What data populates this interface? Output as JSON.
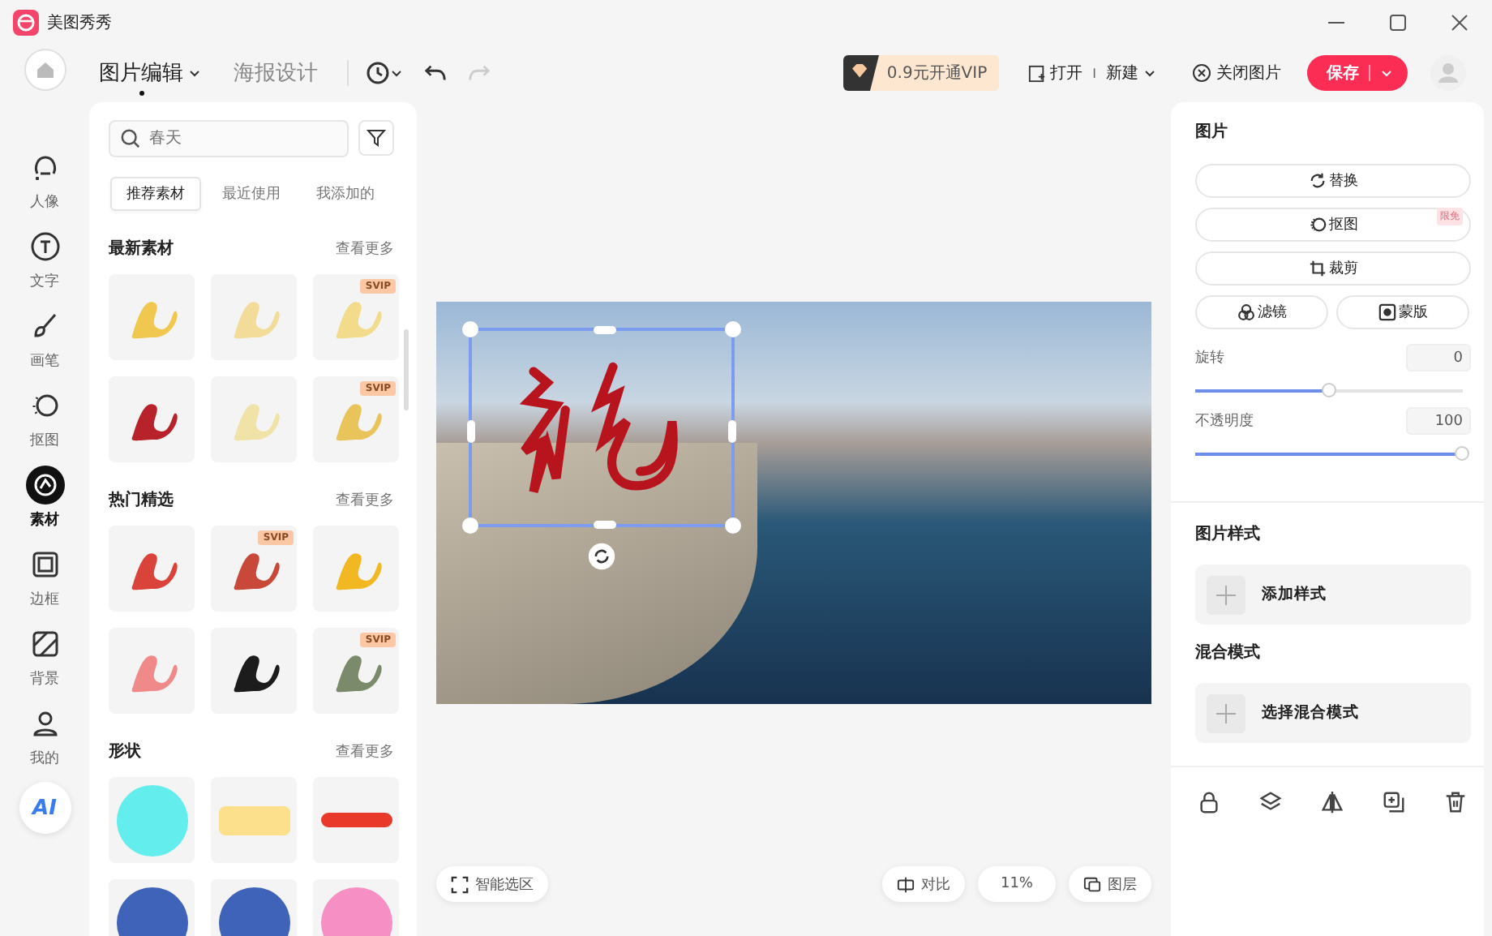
{
  "app": {
    "title": "美图秀秀"
  },
  "toolbar": {
    "modes": [
      {
        "label": "图片编辑",
        "selected": true,
        "dropdown": true
      },
      {
        "label": "海报设计",
        "selected": false,
        "dropdown": false
      }
    ],
    "redo_disabled": true,
    "vip": "0.9元开通VIP",
    "open": "打开",
    "separator": "I",
    "new": "新建",
    "close": "关闭图片",
    "save": "保存"
  },
  "rail": {
    "items": [
      {
        "label": "人像",
        "kind": "portrait",
        "selected": false
      },
      {
        "label": "文字",
        "kind": "text",
        "selected": false
      },
      {
        "label": "画笔",
        "kind": "brush",
        "selected": false
      },
      {
        "label": "抠图",
        "kind": "cutout",
        "selected": false
      },
      {
        "label": "素材",
        "kind": "sticker",
        "selected": true
      },
      {
        "label": "边框",
        "kind": "frame",
        "selected": false
      },
      {
        "label": "背景",
        "kind": "hatch",
        "selected": false
      },
      {
        "label": "我的",
        "kind": "user",
        "selected": false
      }
    ],
    "ai": "AI"
  },
  "panel": {
    "search": {
      "placeholder": "春天"
    },
    "tabs": [
      {
        "label": "推荐素材",
        "selected": true
      },
      {
        "label": "最近使用",
        "selected": false
      },
      {
        "label": "我添加的",
        "selected": false
      }
    ],
    "sections": [
      {
        "title": "最新素材",
        "more": "查看更多",
        "tiles": [
          {
            "kind": "sticker",
            "color": "#f0c850"
          },
          {
            "kind": "sticker",
            "color": "#f3dc9a"
          },
          {
            "kind": "sticker",
            "color": "#f2dc8c",
            "badge": "SVIP"
          },
          {
            "kind": "sticker",
            "color": "#b8222a"
          },
          {
            "kind": "sticker",
            "color": "#f1e2a8"
          },
          {
            "kind": "sticker",
            "color": "#e9c45a",
            "badge": "SVIP"
          }
        ]
      },
      {
        "title": "热门精选",
        "more": "查看更多",
        "tiles": [
          {
            "kind": "sticker",
            "color": "#d9433a"
          },
          {
            "kind": "sticker",
            "color": "#c8483a",
            "badge": "SVIP"
          },
          {
            "kind": "sticker",
            "color": "#f2b823"
          },
          {
            "kind": "sticker",
            "color": "#f08a8a"
          },
          {
            "kind": "sticker",
            "color": "#1c1c1c"
          },
          {
            "kind": "sticker",
            "color": "#7b8a6b",
            "badge": "SVIP"
          }
        ]
      },
      {
        "title": "形状",
        "more": "查看更多",
        "tiles": [
          {
            "kind": "circle",
            "color": "#63eded"
          },
          {
            "kind": "bar",
            "color": "#fde08c"
          },
          {
            "kind": "pill",
            "color": "#e8392a"
          },
          {
            "kind": "circle",
            "color": "#3f63b8"
          },
          {
            "kind": "circle",
            "color": "#3f63b8"
          },
          {
            "kind": "circle",
            "color": "#f58fc4"
          }
        ]
      }
    ]
  },
  "canvas": {
    "smart_select": "智能选区",
    "compare": "对比",
    "zoom": "11%",
    "layers": "图层"
  },
  "properties": {
    "title": "图片",
    "actions": [
      {
        "label": "替换",
        "kind": "refresh",
        "half": false
      },
      {
        "label": "抠图",
        "kind": "cutout",
        "half": false,
        "badge": "限免"
      },
      {
        "label": "裁剪",
        "kind": "crop",
        "half": false
      },
      {
        "label": "滤镜",
        "kind": "filter",
        "half": true
      },
      {
        "label": "蒙版",
        "kind": "mask",
        "half": true
      }
    ],
    "sliders": [
      {
        "label": "旋转",
        "value": "0",
        "level": 0.5
      },
      {
        "label": "不透明度",
        "value": "100",
        "level": 1
      }
    ],
    "groups": [
      {
        "title": "图片样式",
        "button": "添加样式"
      },
      {
        "title": "混合模式",
        "button": "选择混合模式"
      }
    ],
    "tools": [
      {
        "kind": "lock"
      },
      {
        "kind": "layers"
      },
      {
        "kind": "flip"
      },
      {
        "kind": "duplicate"
      },
      {
        "kind": "delete"
      }
    ]
  }
}
